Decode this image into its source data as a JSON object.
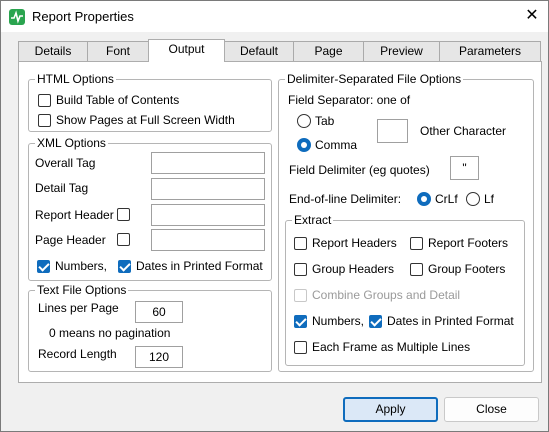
{
  "window": {
    "title": "Report Properties",
    "close_glyph": "✕"
  },
  "tabs": [
    {
      "label": "Details"
    },
    {
      "label": "Font"
    },
    {
      "label": "Output"
    },
    {
      "label": "Default"
    },
    {
      "label": "Page"
    },
    {
      "label": "Preview"
    },
    {
      "label": "Parameters"
    }
  ],
  "active_tab": "Output",
  "html_options": {
    "title": "HTML Options",
    "build_toc": {
      "label": "Build Table of Contents",
      "checked": false
    },
    "full_screen": {
      "label": "Show Pages at Full Screen Width",
      "checked": false
    }
  },
  "xml_options": {
    "title": "XML Options",
    "overall_tag": {
      "label": "Overall Tag",
      "value": ""
    },
    "detail_tag": {
      "label": "Detail Tag",
      "value": ""
    },
    "report_header": {
      "label": "Report Header",
      "checked": false,
      "value": ""
    },
    "page_header": {
      "label": "Page Header",
      "checked": false,
      "value": ""
    },
    "numbers": {
      "label": "Numbers,",
      "checked": true
    },
    "dates": {
      "label": "Dates in Printed Format",
      "checked": true
    }
  },
  "text_options": {
    "title": "Text File Options",
    "lines_per_page": {
      "label": "Lines per Page",
      "value": "60"
    },
    "note": "0 means no pagination",
    "record_length": {
      "label": "Record Length",
      "value": "120"
    }
  },
  "delimiter_options": {
    "title": "Delimiter-Separated File Options",
    "field_separator_label": "Field Separator: one of",
    "tab": {
      "label": "Tab",
      "selected": false
    },
    "comma": {
      "label": "Comma",
      "selected": true
    },
    "other_character": {
      "label": "Other Character",
      "value": ""
    },
    "field_delimiter": {
      "label": "Field Delimiter (eg quotes)",
      "value": "\""
    },
    "eol_label": "End-of-line Delimiter:",
    "crlf": {
      "label": "CrLf",
      "selected": true
    },
    "lf": {
      "label": "Lf",
      "selected": false
    }
  },
  "extract": {
    "title": "Extract",
    "report_headers": {
      "label": "Report Headers",
      "checked": false
    },
    "report_footers": {
      "label": "Report Footers",
      "checked": false
    },
    "group_headers": {
      "label": "Group Headers",
      "checked": false
    },
    "group_footers": {
      "label": "Group Footers",
      "checked": false
    },
    "combine": {
      "label": "Combine Groups and Detail",
      "checked": false,
      "disabled": true
    },
    "numbers": {
      "label": "Numbers,",
      "checked": true
    },
    "dates": {
      "label": "Dates in Printed Format",
      "checked": true
    },
    "each_frame": {
      "label": "Each Frame as Multiple Lines",
      "checked": false
    }
  },
  "buttons": {
    "apply": "Apply",
    "close": "Close"
  },
  "colors": {
    "accent": "#0f6cbd",
    "icon": "#2aa44f"
  }
}
